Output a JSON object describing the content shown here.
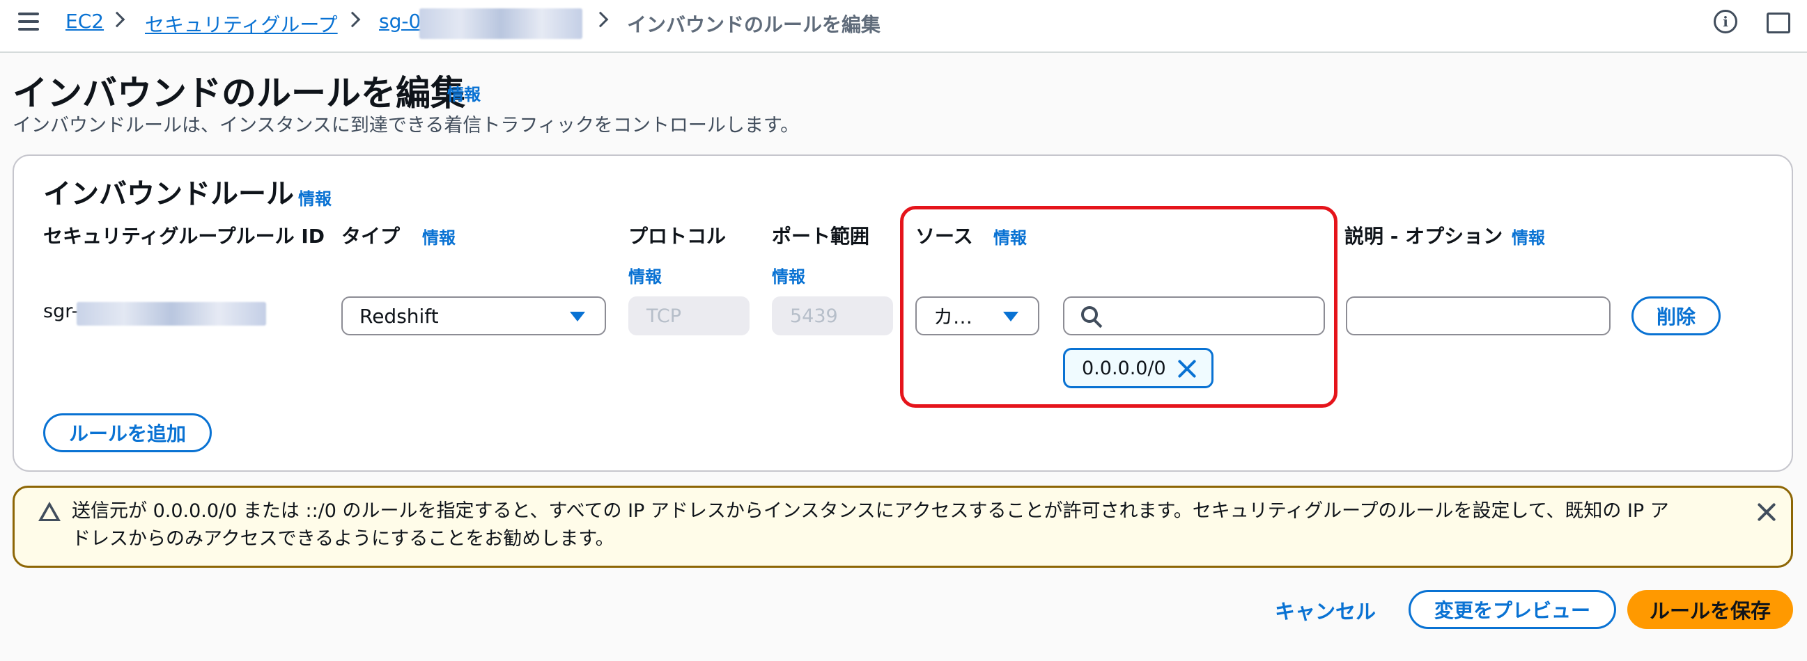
{
  "breadcrumb": {
    "items": [
      "EC2",
      "セキュリティグループ",
      "sg-0"
    ],
    "current": "インバウンドのルールを編集"
  },
  "header": {
    "title": "インバウンドのルールを編集",
    "info": "情報",
    "description": "インバウンドルールは、インスタンスに到達できる着信トラフィックをコントロールします。"
  },
  "rules_section": {
    "title": "インバウンドルール",
    "info": "情報",
    "columns": {
      "rule_id": "セキュリティグループルール ID",
      "type": "タイプ",
      "protocol": "プロトコル",
      "port_range": "ポート範囲",
      "source": "ソース",
      "description": "説明 - オプション",
      "info": "情報"
    },
    "row": {
      "rule_id": "sgr-",
      "type": "Redshift",
      "protocol": "TCP",
      "port": "5439",
      "source_type": "カ…",
      "source_search": "",
      "source_token": "0.0.0.0/0",
      "description": "",
      "delete_label": "削除"
    },
    "add_rule_label": "ルールを追加"
  },
  "warning": {
    "line1": "送信元が 0.0.0.0/0 または ::/0 のルールを指定すると、すべての IP アドレスからインスタンスにアクセスすることが許可されます。セキュリティグループのルールを設定して、既知の IP ア",
    "line2": "ドレスからのみアクセスできるようにすることをお勧めします。"
  },
  "footer": {
    "cancel": "キャンセル",
    "preview": "変更をプレビュー",
    "save": "ルールを保存"
  },
  "icons": [
    "menu-icon",
    "info-icon",
    "feedback-screen-icon",
    "caret-down-icon",
    "search-icon",
    "remove-token-icon",
    "warning-icon",
    "dismiss-icon"
  ],
  "colors": {
    "link": "#0972d3",
    "primary": "#ff9900",
    "highlight": "#e5141b",
    "warning_border": "#8d6605"
  }
}
